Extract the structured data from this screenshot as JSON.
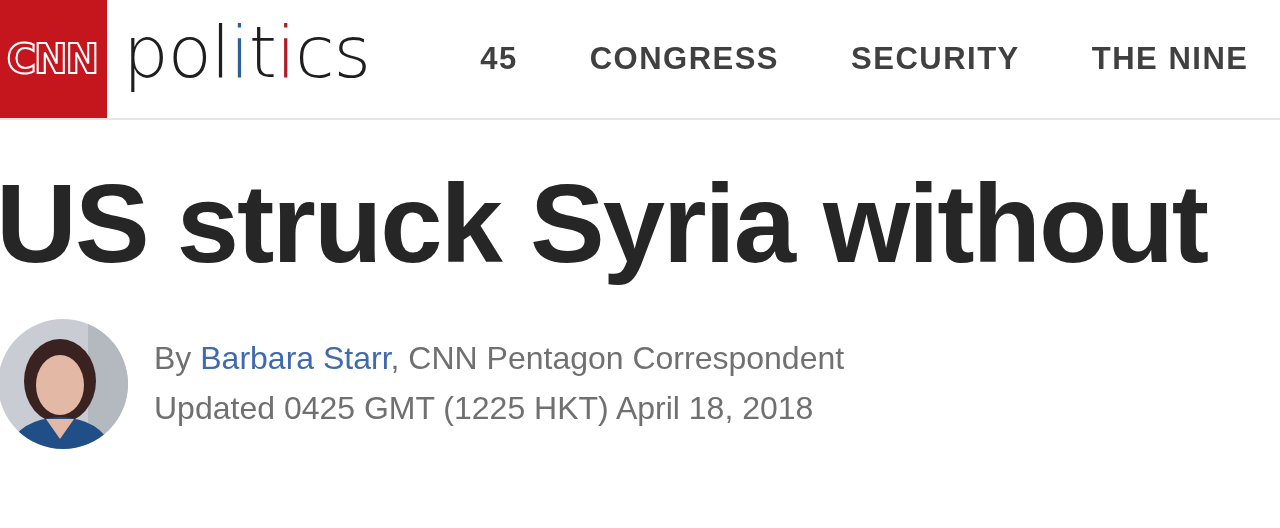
{
  "header": {
    "logo": "CNN",
    "wordmark": [
      {
        "text": "pol",
        "color": "#1e1e1e"
      },
      {
        "text": "i",
        "color": "#2d6096"
      },
      {
        "text": "t",
        "color": "#1e1e1e"
      },
      {
        "text": "i",
        "color": "#b01c24"
      },
      {
        "text": "cs",
        "color": "#1e1e1e"
      }
    ],
    "nav": [
      "45",
      "CONGRESS",
      "SECURITY",
      "THE NINE"
    ]
  },
  "article": {
    "headline": "US struck Syria without",
    "byline_prefix": "By",
    "author": "Barbara Starr",
    "author_title": ", CNN Pentagon Correspondent",
    "updated": "Updated 0425 GMT (1225 HKT) April 18, 2018"
  }
}
